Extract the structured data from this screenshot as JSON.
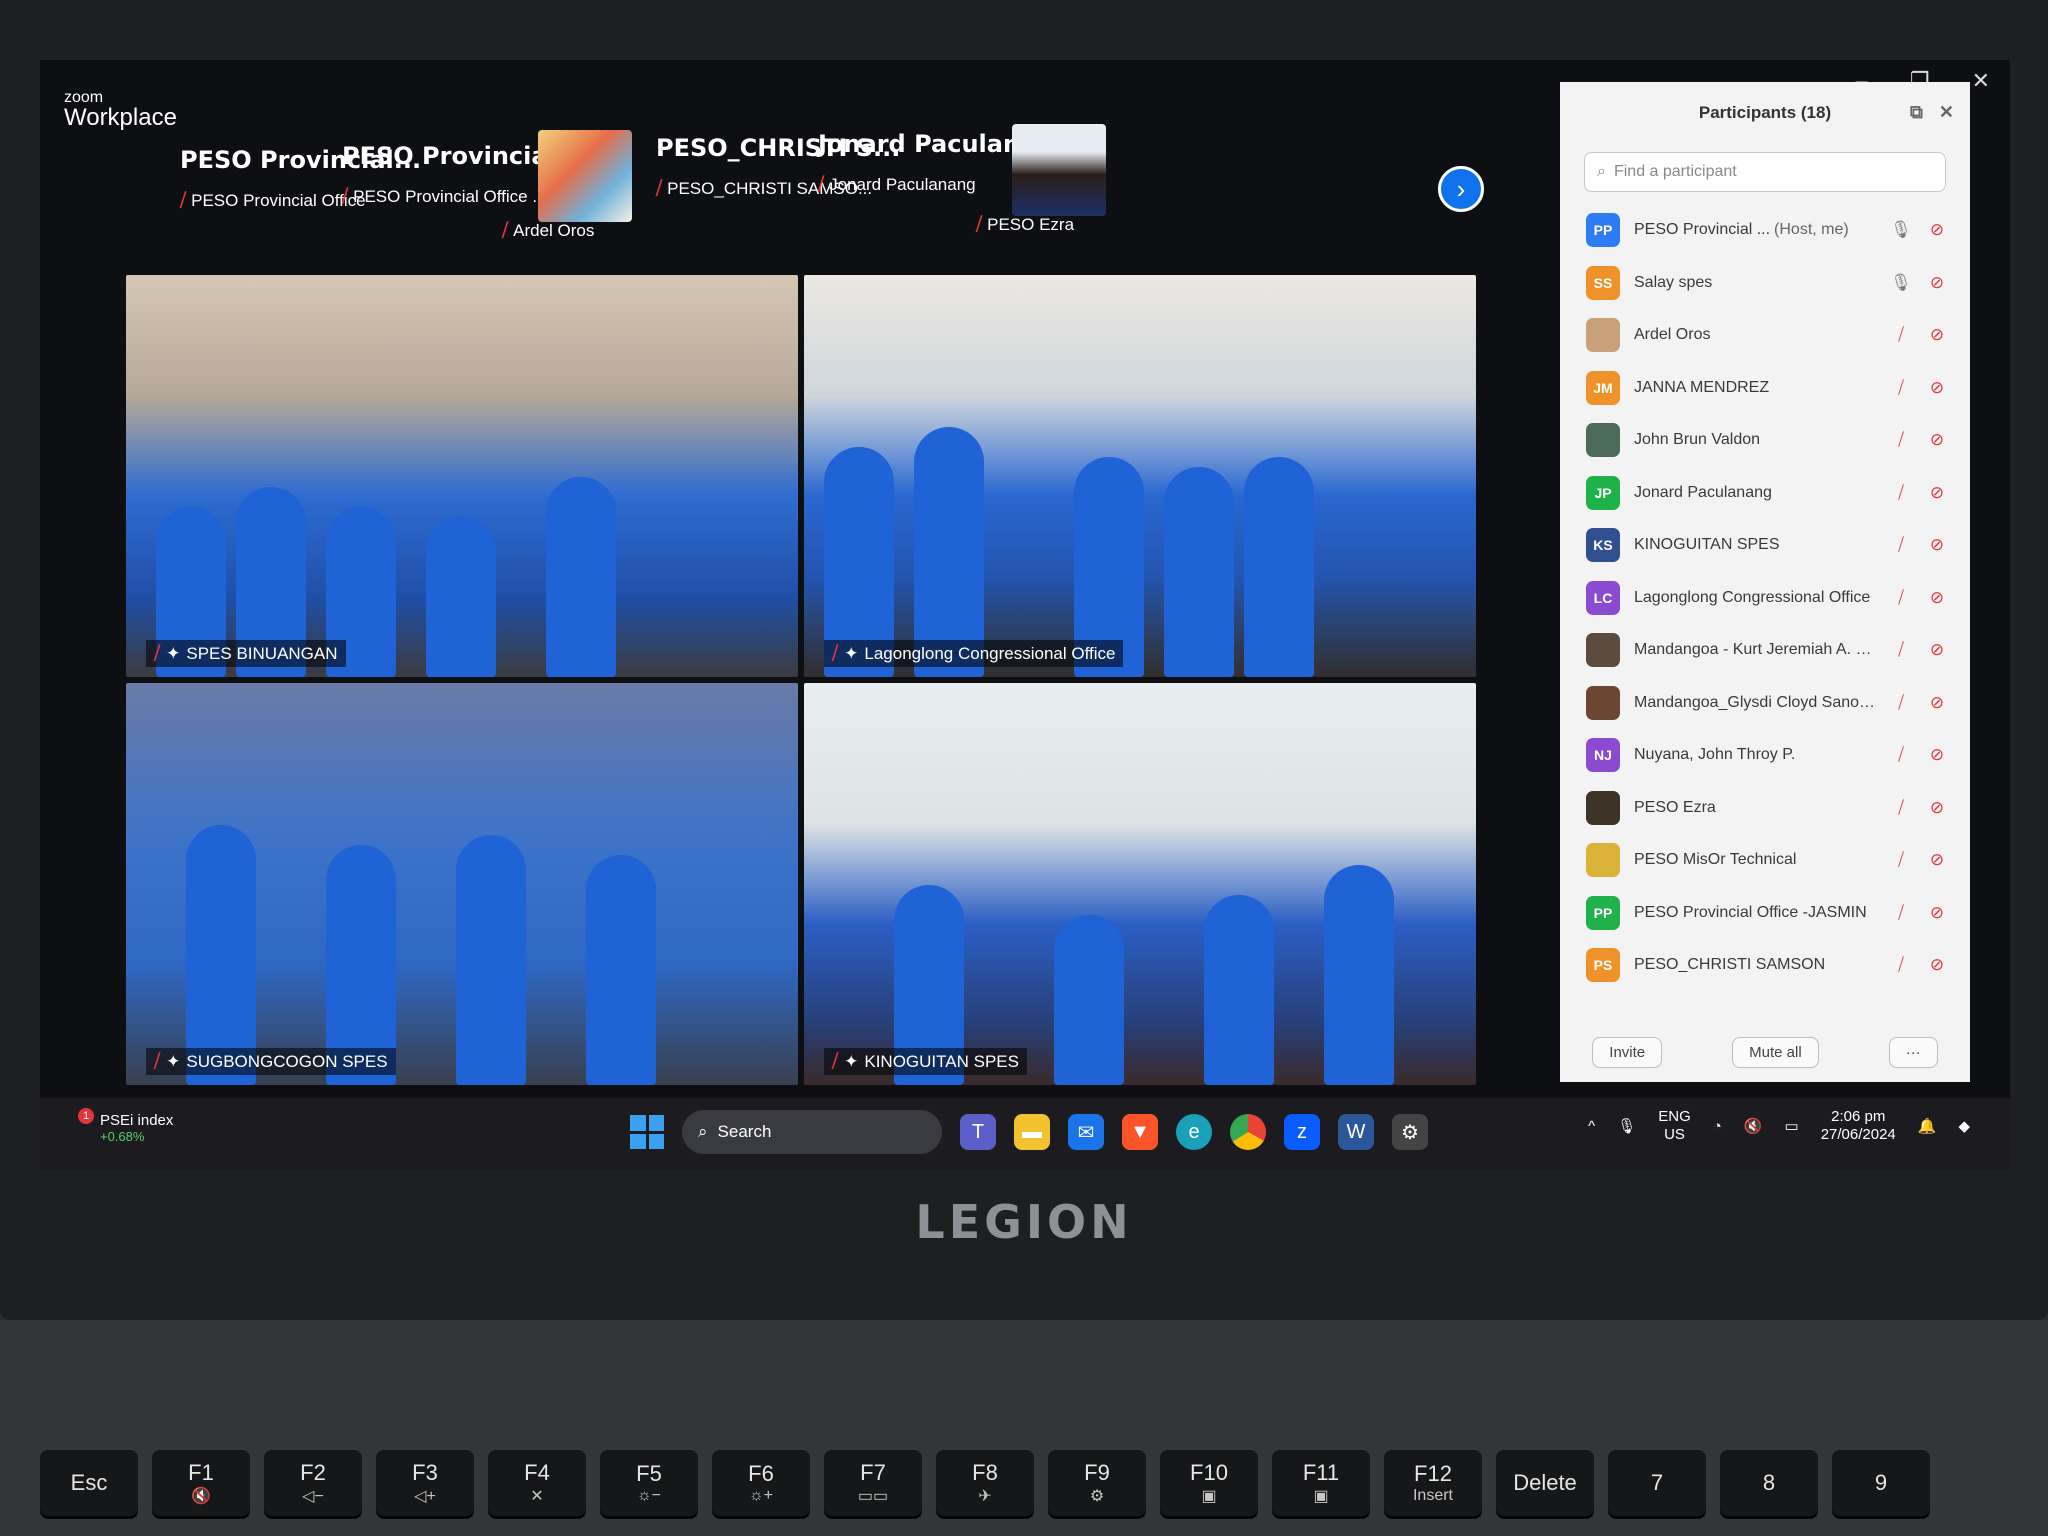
{
  "zoom": {
    "brand_small": "zoom",
    "brand_large": "Workplace"
  },
  "window_controls": [
    "–",
    "❐",
    "✕"
  ],
  "strip": {
    "tiles": [
      {
        "big": "PESO  Provincial...",
        "name": "PESO Provincial Office"
      },
      {
        "big": "PESO  Provincial...",
        "name": "PESO Provincial Office ..."
      },
      {
        "big": "",
        "name": "Ardel Oros"
      },
      {
        "big": "PESO_CHRISTI  S...",
        "name": "PESO_CHRISTI SAMSO..."
      },
      {
        "big": "Jonard  Paculan...",
        "name": "Jonard Paculanang"
      },
      {
        "big": "",
        "name": "PESO Ezra"
      }
    ]
  },
  "videos": [
    {
      "label": "SPES BINUANGAN"
    },
    {
      "label": "Lagonglong Congressional Office"
    },
    {
      "label": "SUGBONGCOGON SPES"
    },
    {
      "label": "KINOGUITAN SPES"
    }
  ],
  "participants": {
    "title": "Participants (18)",
    "search_placeholder": "Find a participant",
    "items": [
      {
        "initials": "PP",
        "color": "#2d7cf6",
        "name": "PESO Provincial ...",
        "host": "(Host, me)",
        "mic": "on"
      },
      {
        "initials": "SS",
        "color": "#f0922b",
        "name": "Salay spes",
        "mic": "on"
      },
      {
        "initials": "",
        "color": "#c8a07a",
        "name": "Ardel Oros",
        "mic": "off"
      },
      {
        "initials": "JM",
        "color": "#f0922b",
        "name": "JANNA MENDREZ",
        "mic": "off"
      },
      {
        "initials": "",
        "color": "#4b6b58",
        "name": "John Brun Valdon",
        "mic": "off"
      },
      {
        "initials": "JP",
        "color": "#1fb24a",
        "name": "Jonard Paculanang",
        "mic": "off"
      },
      {
        "initials": "KS",
        "color": "#2f4f8f",
        "name": "KINOGUITAN SPES",
        "mic": "off"
      },
      {
        "initials": "LC",
        "color": "#8a4bd1",
        "name": "Lagonglong Congressional Office",
        "mic": "off"
      },
      {
        "initials": "",
        "color": "#5b4a3e",
        "name": "Mandangoa - Kurt Jeremiah A. R...",
        "mic": "off"
      },
      {
        "initials": "",
        "color": "#6b4633",
        "name": "Mandangoa_Glysdi Cloyd Sanoria",
        "mic": "off"
      },
      {
        "initials": "NJ",
        "color": "#8a4bd1",
        "name": "Nuyana, John Throy P.",
        "mic": "off"
      },
      {
        "initials": "",
        "color": "#3d3326",
        "name": "PESO Ezra",
        "mic": "off"
      },
      {
        "initials": "",
        "color": "#d8b338",
        "name": "PESO MisOr Technical",
        "mic": "off"
      },
      {
        "initials": "PP",
        "color": "#1fb24a",
        "name": "PESO Provincial Office -JASMIN",
        "mic": "off"
      },
      {
        "initials": "PS",
        "color": "#f0922b",
        "name": "PESO_CHRISTI SAMSON",
        "mic": "off"
      }
    ],
    "invite_label": "Invite",
    "mute_all_label": "Mute all",
    "more_label": "···"
  },
  "taskbar": {
    "stock_badge": "1",
    "stock_name": "PSEi index",
    "stock_change": "+0.68%",
    "search_label": "Search",
    "lang_top": "ENG",
    "lang_bottom": "US",
    "time": "2:06 pm",
    "date": "27/06/2024"
  },
  "laptop_brand": "LEGION",
  "keys": [
    {
      "top": "Esc",
      "sub": ""
    },
    {
      "top": "F1",
      "sub": "🔇"
    },
    {
      "top": "F2",
      "sub": "◁−"
    },
    {
      "top": "F3",
      "sub": "◁+"
    },
    {
      "top": "F4",
      "sub": "✕"
    },
    {
      "top": "F5",
      "sub": "☼−"
    },
    {
      "top": "F6",
      "sub": "☼+"
    },
    {
      "top": "F7",
      "sub": "▭▭"
    },
    {
      "top": "F8",
      "sub": "✈"
    },
    {
      "top": "F9",
      "sub": "⚙"
    },
    {
      "top": "F10",
      "sub": "▣"
    },
    {
      "top": "F11",
      "sub": "▣"
    },
    {
      "top": "F12",
      "sub": "Insert"
    },
    {
      "top": "Delete",
      "sub": ""
    },
    {
      "top": "7",
      "sub": ""
    },
    {
      "top": "8",
      "sub": ""
    },
    {
      "top": "9",
      "sub": ""
    }
  ]
}
